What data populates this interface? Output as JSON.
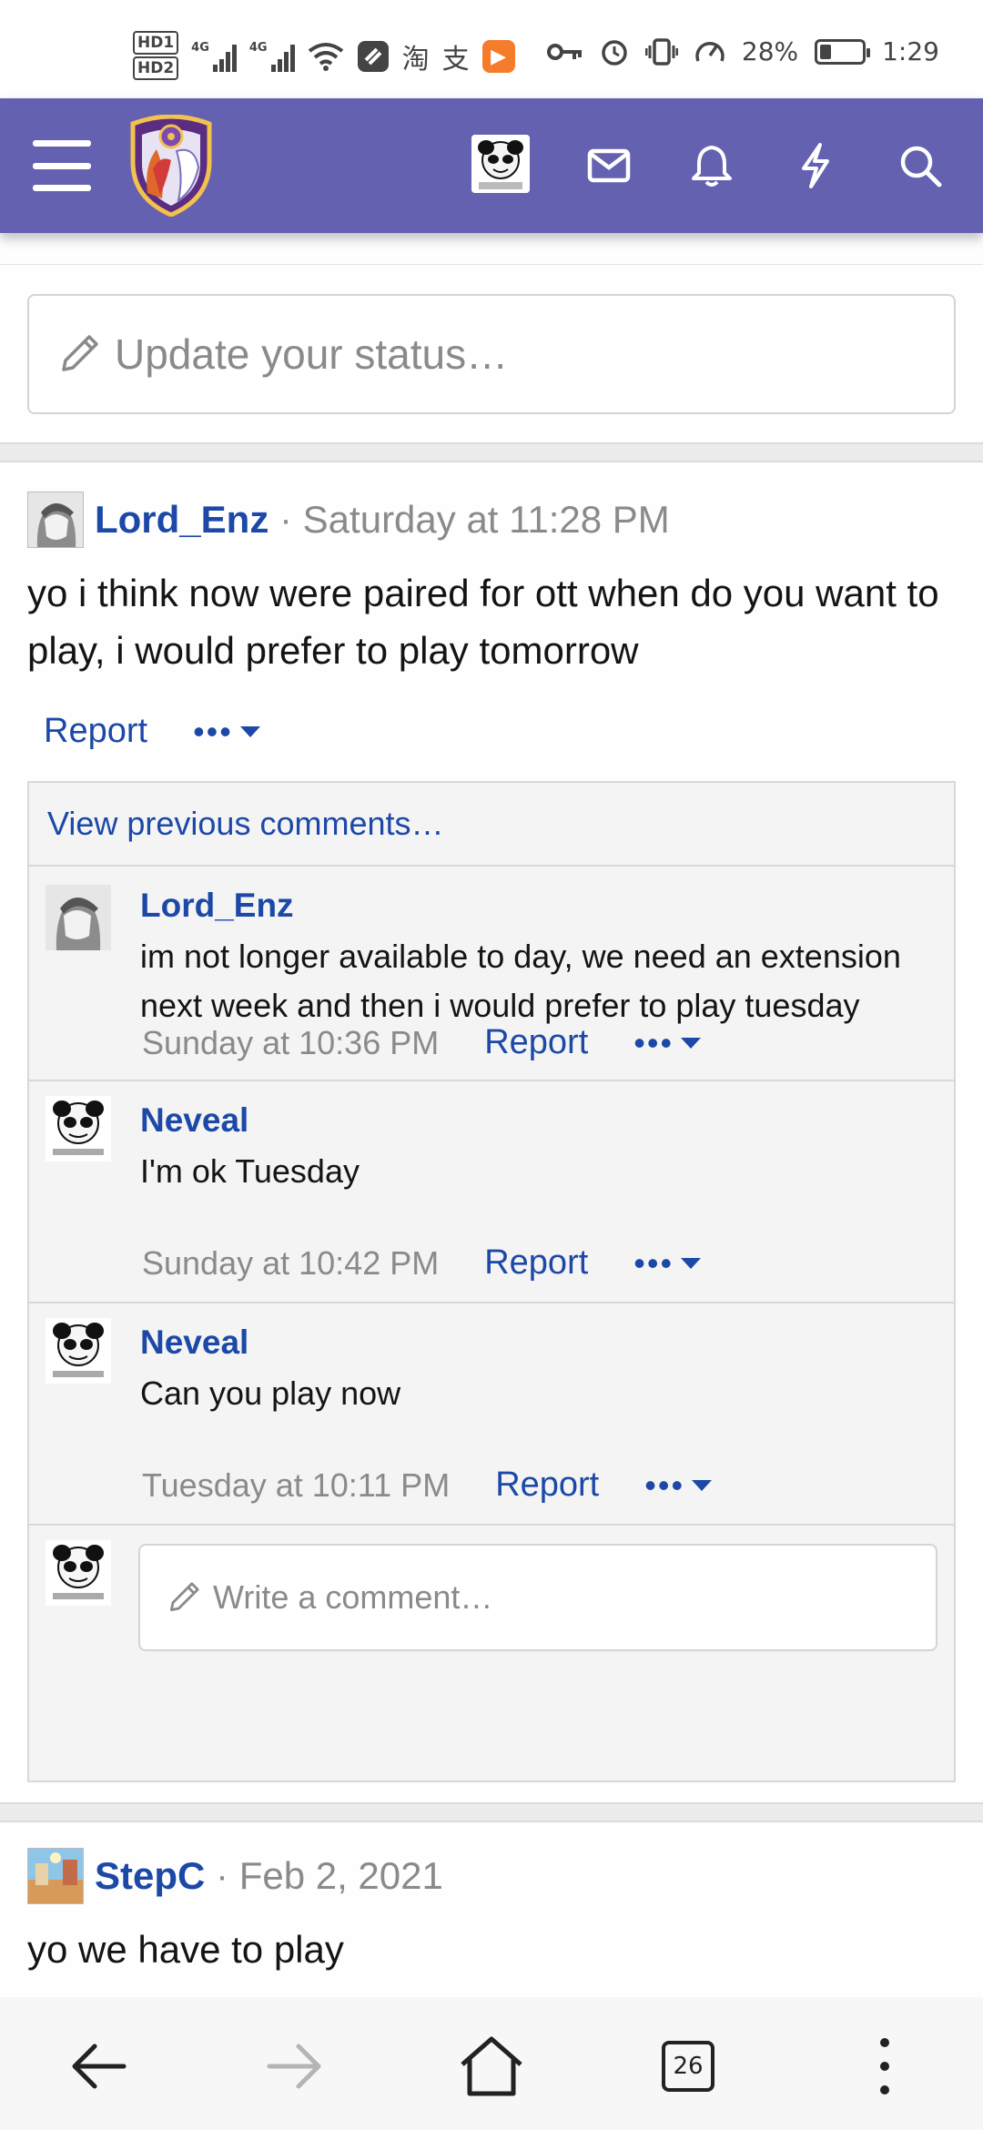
{
  "status_bar": {
    "hd1": "HD1",
    "hd2": "HD2",
    "net1": "4G",
    "net2": "4G",
    "app1": "淘",
    "app2": "支",
    "battery_percent": "28%",
    "battery_level": 0.28,
    "time": "1:29"
  },
  "header": {
    "menu_icon": "hamburger-icon",
    "logo": "forum-shield-logo",
    "icons": [
      "inbox-icon",
      "bell-icon",
      "lightning-icon",
      "search-icon"
    ],
    "accent": "#6561b1"
  },
  "status_update": {
    "placeholder": "Update your status…"
  },
  "post": {
    "author": "Lord_Enz",
    "separator": "·",
    "time": "Saturday at 11:28 PM",
    "body": "yo i think now were paired for ott when do you want to play, i would prefer to play tomorrow",
    "report": "Report",
    "more": "•••",
    "view_previous": "View previous comments…",
    "comments": [
      {
        "author": "Lord_Enz",
        "text": "im not longer available to day, we need an extension next week and then i would prefer to play tuesday",
        "time": "Sunday at 10:36 PM",
        "report": "Report",
        "more": "•••"
      },
      {
        "author": "Neveal",
        "text": "I'm ok Tuesday",
        "time": "Sunday at 10:42 PM",
        "report": "Report",
        "more": "•••"
      },
      {
        "author": "Neveal",
        "text": "Can you play now",
        "time": "Tuesday at 10:11 PM",
        "report": "Report",
        "more": "•••"
      }
    ],
    "write_placeholder": "Write a comment…"
  },
  "post2": {
    "author": "StepC",
    "separator": "·",
    "time": "Feb 2, 2021",
    "body": "yo we have to play"
  },
  "bottom_nav": {
    "tab_count": "26"
  },
  "colors": {
    "link": "#1c48a7",
    "muted": "#8a8a8a",
    "comment_bg": "#f4f4f4"
  }
}
